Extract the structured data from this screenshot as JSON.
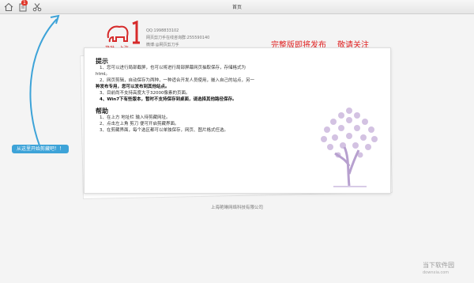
{
  "window": {
    "title": "首页"
  },
  "toolbar": {
    "badge": "1"
  },
  "hint": "从这里开始剪藏吧！！",
  "logo": {
    "text": "艳琳 · 上海"
  },
  "contact": {
    "qq": "QQ:1998833102",
    "group": "网页剪刀手在线咨询群:255590140",
    "weibo": "微博:@网页剪刀手"
  },
  "promo": {
    "part1": "完整版即将发布",
    "part2": "敬请关注"
  },
  "tips": {
    "title": "提示",
    "l1": "1、您可以进行局部截屏，也可以将进行局部屏幕网页抽取保存，存储格式为",
    "l1b": "html。",
    "l2a": "2、网页剪辑，自动保存为两种，一种适合开发人员使用，嵌入自己的站点，另一",
    "l2b": "种发布专用，您可以发布到其他站点。",
    "l3": "3、目前尚不支持高度大于32000像素的页面。",
    "l4": "4、Win7下有些版本，暂时不支持保存到桌面，请选择其他路径保存。"
  },
  "help": {
    "title": "帮助",
    "l1": "1、在上方 地址栏 输入待剪藏网址。",
    "l2": "2、点击左上角 剪刀 便可开启剪藏界面。",
    "l3": "3、在剪藏界面，每个选区都可以单独保存，网页、图片格式任选。"
  },
  "footer": "上海艳琳网络科技有限公司",
  "watermark": {
    "name": "当下软件园",
    "url": "downxia.com"
  }
}
